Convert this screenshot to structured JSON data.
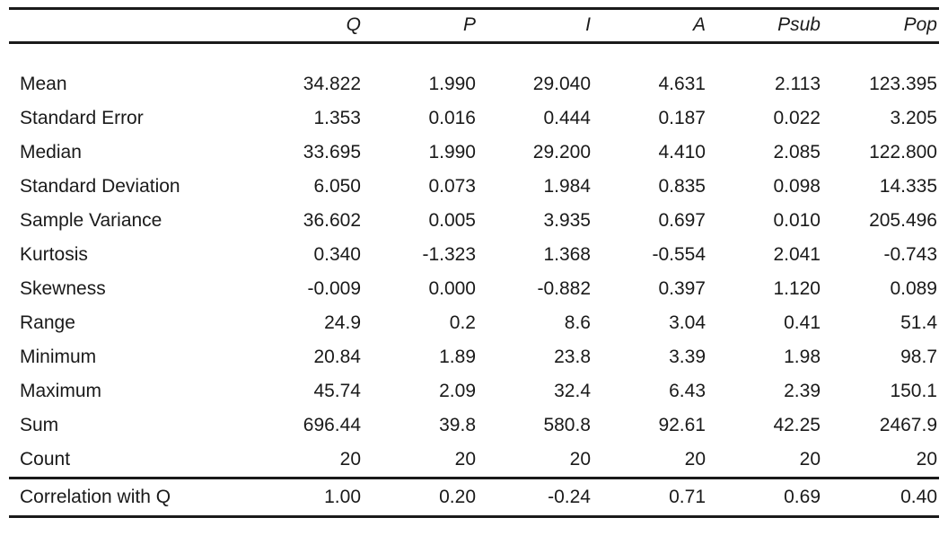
{
  "table": {
    "corner_label": "",
    "columns": [
      "Q",
      "P",
      "I",
      "A",
      "Psub",
      "Pop"
    ],
    "rows": [
      {
        "label": "Mean",
        "values": [
          "34.822",
          "1.990",
          "29.040",
          "4.631",
          "2.113",
          "123.395"
        ]
      },
      {
        "label": "Standard Error",
        "values": [
          "1.353",
          "0.016",
          "0.444",
          "0.187",
          "0.022",
          "3.205"
        ]
      },
      {
        "label": "Median",
        "values": [
          "33.695",
          "1.990",
          "29.200",
          "4.410",
          "2.085",
          "122.800"
        ]
      },
      {
        "label": "Standard Deviation",
        "values": [
          "6.050",
          "0.073",
          "1.984",
          "0.835",
          "0.098",
          "14.335"
        ]
      },
      {
        "label": "Sample Variance",
        "values": [
          "36.602",
          "0.005",
          "3.935",
          "0.697",
          "0.010",
          "205.496"
        ]
      },
      {
        "label": "Kurtosis",
        "values": [
          "0.340",
          "-1.323",
          "1.368",
          "-0.554",
          "2.041",
          "-0.743"
        ]
      },
      {
        "label": "Skewness",
        "values": [
          "-0.009",
          "0.000",
          "-0.882",
          "0.397",
          "1.120",
          "0.089"
        ]
      },
      {
        "label": "Range",
        "values": [
          "24.9",
          "0.2",
          "8.6",
          "3.04",
          "0.41",
          "51.4"
        ]
      },
      {
        "label": "Minimum",
        "values": [
          "20.84",
          "1.89",
          "23.8",
          "3.39",
          "1.98",
          "98.7"
        ]
      },
      {
        "label": "Maximum",
        "values": [
          "45.74",
          "2.09",
          "32.4",
          "6.43",
          "2.39",
          "150.1"
        ]
      },
      {
        "label": "Sum",
        "values": [
          "696.44",
          "39.8",
          "580.8",
          "92.61",
          "42.25",
          "2467.9"
        ]
      },
      {
        "label": "Count",
        "values": [
          "20",
          "20",
          "20",
          "20",
          "20",
          "20"
        ]
      }
    ],
    "footer_row": {
      "label": "Correlation with Q",
      "values": [
        "1.00",
        "0.20",
        "-0.24",
        "0.71",
        "0.69",
        "0.40"
      ]
    }
  },
  "chart_data": {
    "type": "table",
    "title": "",
    "categories": [
      "Q",
      "P",
      "I",
      "A",
      "Psub",
      "Pop"
    ],
    "row_names": [
      "Mean",
      "Standard Error",
      "Median",
      "Standard Deviation",
      "Sample Variance",
      "Kurtosis",
      "Skewness",
      "Range",
      "Minimum",
      "Maximum",
      "Sum",
      "Count",
      "Correlation with Q"
    ],
    "series": [
      {
        "name": "Q",
        "values": [
          34.822,
          1.353,
          33.695,
          6.05,
          36.602,
          0.34,
          -0.009,
          24.9,
          20.84,
          45.74,
          696.44,
          20,
          1.0
        ]
      },
      {
        "name": "P",
        "values": [
          1.99,
          0.016,
          1.99,
          0.073,
          0.005,
          -1.323,
          0.0,
          0.2,
          1.89,
          2.09,
          39.8,
          20,
          0.2
        ]
      },
      {
        "name": "I",
        "values": [
          29.04,
          0.444,
          29.2,
          1.984,
          3.935,
          1.368,
          -0.882,
          8.6,
          23.8,
          32.4,
          580.8,
          20,
          -0.24
        ]
      },
      {
        "name": "A",
        "values": [
          4.631,
          0.187,
          4.41,
          0.835,
          0.697,
          -0.554,
          0.397,
          3.04,
          3.39,
          6.43,
          92.61,
          20,
          0.71
        ]
      },
      {
        "name": "Psub",
        "values": [
          2.113,
          0.022,
          2.085,
          0.098,
          0.01,
          2.041,
          1.12,
          0.41,
          1.98,
          2.39,
          42.25,
          20,
          0.69
        ]
      },
      {
        "name": "Pop",
        "values": [
          123.395,
          3.205,
          122.8,
          14.335,
          205.496,
          -0.743,
          0.089,
          51.4,
          98.7,
          150.1,
          2467.9,
          20,
          0.4
        ]
      }
    ]
  },
  "style": {
    "text_color": "#1a1a1a",
    "background": "#ffffff",
    "rule_color": "#1a1a1a"
  }
}
